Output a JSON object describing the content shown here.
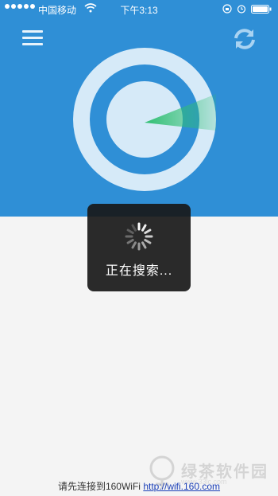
{
  "status_bar": {
    "carrier": "中国移动",
    "time": "下午3:13"
  },
  "toolbar": {
    "menu_icon": "hamburger-menu",
    "refresh_icon": "refresh-arrows"
  },
  "radar": {
    "outer_ring_color": "#d6eaf8",
    "inner_ring_color": "#2f8fd6",
    "sweep_color": "#2fbf71"
  },
  "toast": {
    "text": "正在搜索..."
  },
  "footer": {
    "prefix": "请先连接到160WiFi",
    "link": "http://wifi.160.com"
  },
  "watermark": {
    "text": "绿茶软件园",
    "url": "www.33lc.com"
  },
  "colors": {
    "header_blue": "#2f8fd6",
    "page_bg": "#f4f4f4"
  }
}
